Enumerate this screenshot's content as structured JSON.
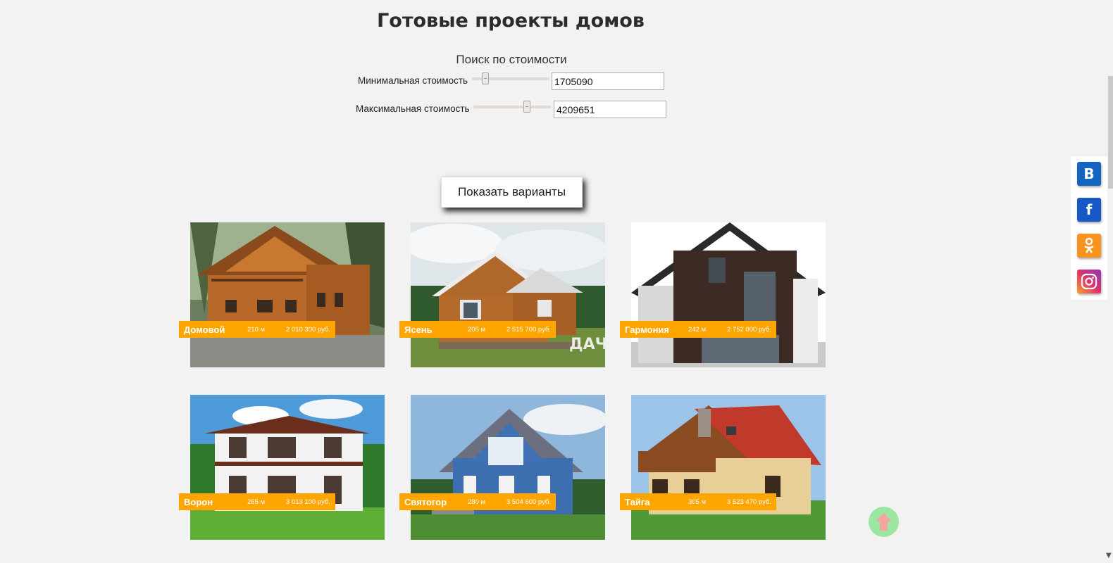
{
  "page": {
    "title": "Готовые проекты домов"
  },
  "search": {
    "title": "Поиск по стоимости",
    "min_label": "Минимальная стоимость",
    "min_value": "1705090",
    "max_label": "Максимальная стоимость",
    "max_value": "4209651",
    "min_slider_level": 0.17,
    "max_slider_level": 0.7
  },
  "show_button_label": "Показать варианты",
  "houses": [
    {
      "name": "Домовой",
      "area": "210 м",
      "price": "2 010 300 руб."
    },
    {
      "name": "Ясень",
      "area": "205 м",
      "price": "2 515 700 руб."
    },
    {
      "name": "Гармония",
      "area": "242 м",
      "price": "2 752 000 руб."
    },
    {
      "name": "Ворон",
      "area": "265 м",
      "price": "3 013 100 руб."
    },
    {
      "name": "Святогор",
      "area": "280 м",
      "price": "3 504 600 руб."
    },
    {
      "name": "Тайга",
      "area": "305 м",
      "price": "3 523 470 руб."
    }
  ],
  "watermark": "ДАЧ",
  "social": {
    "vk": "B",
    "facebook": "f",
    "ok": "ok-icon",
    "instagram": "instagram-icon"
  },
  "colors": {
    "accent": "#ffa500",
    "vk": "#1565c0",
    "facebook": "#1659c4",
    "ok": "#f7931e",
    "to_top": "#9be6a0"
  }
}
